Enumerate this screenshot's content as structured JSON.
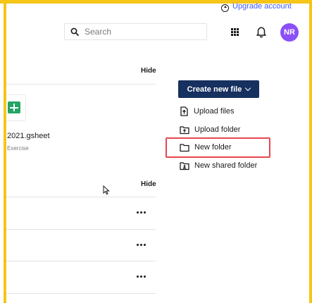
{
  "header": {
    "upgrade_label": "Upgrade account",
    "search_placeholder": "Search",
    "avatar_initials": "NR"
  },
  "recents": {
    "hide_label": "Hide",
    "file": {
      "name": "2021.gsheet",
      "subtitle": "Exercise",
      "icon": "google-sheets-icon"
    }
  },
  "starred": {
    "hide_label": "Hide",
    "row_count": 3
  },
  "actions": {
    "create_label": "Create new file",
    "items": [
      {
        "label": "Upload files",
        "icon": "upload-file-icon"
      },
      {
        "label": "Upload folder",
        "icon": "upload-folder-icon"
      },
      {
        "label": "New folder",
        "icon": "folder-icon"
      },
      {
        "label": "New shared folder",
        "icon": "shared-folder-icon"
      }
    ]
  },
  "colors": {
    "accent_frame": "#f5c518",
    "primary_button": "#16305f",
    "avatar": "#8b4ff7",
    "highlight": "#e5484d",
    "link": "#3d5afe",
    "sheets_green": "#23a566"
  }
}
